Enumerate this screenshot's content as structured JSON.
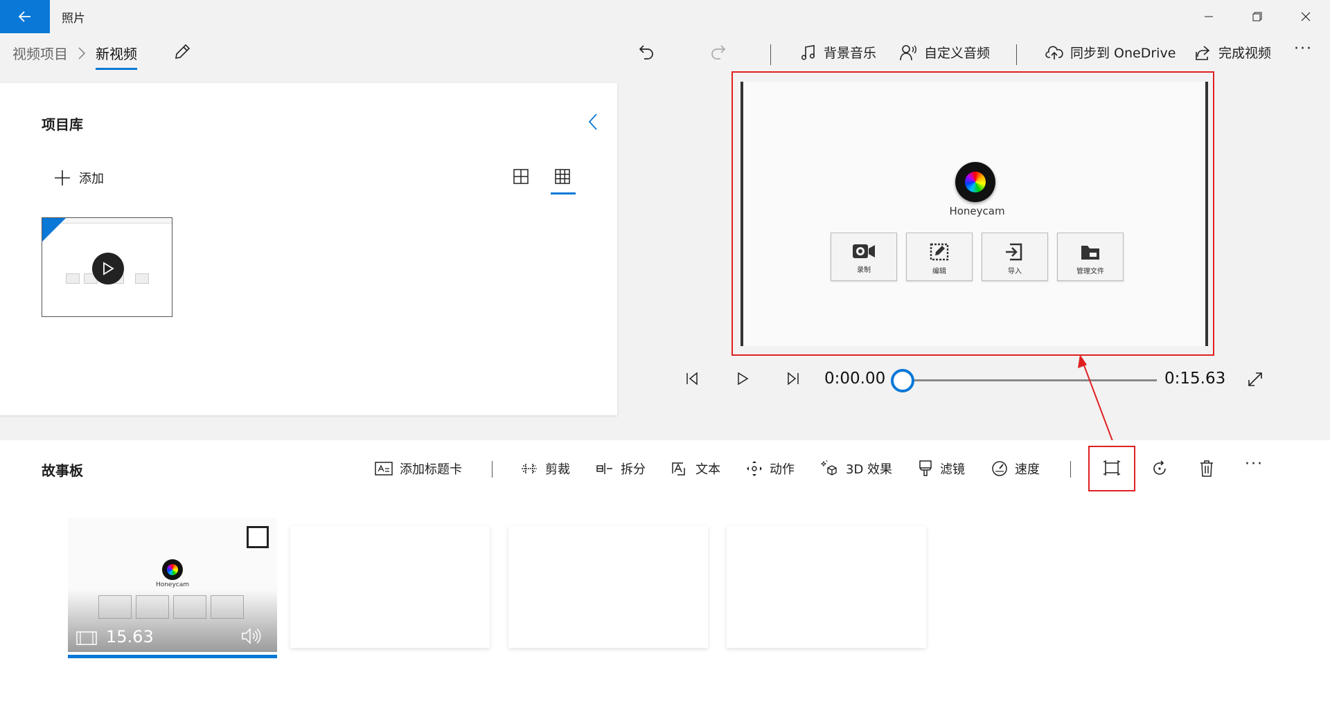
{
  "titlebar": {
    "app_title": "照片"
  },
  "breadcrumb": {
    "parent": "视频项目",
    "separator": "›",
    "current": "新视频"
  },
  "toolbar": {
    "background_music": "背景音乐",
    "custom_audio": "自定义音频",
    "sync_onedrive": "同步到 OneDrive",
    "finish_video": "完成视频",
    "more": "···"
  },
  "library": {
    "title": "项目库",
    "add_label": "添加"
  },
  "preview": {
    "app_name": "Honeycam",
    "buttons": [
      "录制",
      "编辑",
      "导入",
      "管理文件"
    ]
  },
  "playback": {
    "current_time": "0:00.00",
    "total_time": "0:15.63",
    "progress": 0
  },
  "storyboard": {
    "title": "故事板",
    "tools": {
      "add_title_card": "添加标题卡",
      "trim": "剪裁",
      "split": "拆分",
      "text": "文本",
      "motion": "动作",
      "effects_3d": "3D 效果",
      "filters": "滤镜",
      "speed": "速度"
    },
    "more": "···",
    "clip": {
      "duration": "15.63",
      "app_name": "Honeycam"
    }
  },
  "colors": {
    "accent": "#0a78d7",
    "highlight": "#e02020"
  }
}
